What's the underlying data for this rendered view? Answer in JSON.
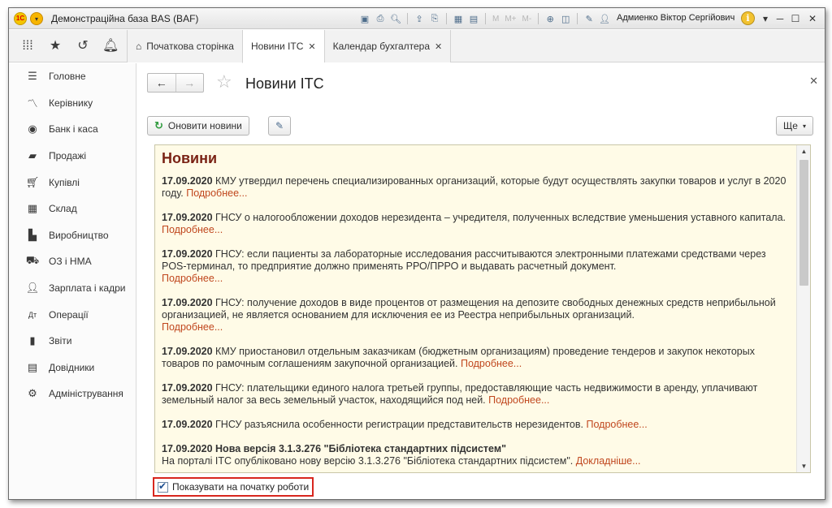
{
  "window": {
    "title": "Демонстраційна база BAS  (BAF)",
    "user": "Адмиенко Віктор Сергійович",
    "toolbar_labels": {
      "m": "M",
      "m_plus": "M+",
      "m_minus": "M-"
    }
  },
  "tabs": [
    {
      "label": "Початкова сторінка",
      "active": false,
      "closable": false
    },
    {
      "label": "Новини ІТС",
      "active": true,
      "closable": true
    },
    {
      "label": "Календар бухгалтера",
      "active": false,
      "closable": true
    }
  ],
  "sidebar": {
    "items": [
      {
        "label": "Головне",
        "icon": "menu-lines-icon"
      },
      {
        "label": "Керівнику",
        "icon": "trend-icon"
      },
      {
        "label": "Банк і каса",
        "icon": "coin-icon"
      },
      {
        "label": "Продажі",
        "icon": "bag-icon"
      },
      {
        "label": "Купівлі",
        "icon": "cart-icon"
      },
      {
        "label": "Склад",
        "icon": "grid-icon"
      },
      {
        "label": "Виробництво",
        "icon": "factory-icon"
      },
      {
        "label": "ОЗ і НМА",
        "icon": "truck-icon"
      },
      {
        "label": "Зарплата і кадри",
        "icon": "person-icon"
      },
      {
        "label": "Операції",
        "icon": "dt-kt-icon"
      },
      {
        "label": "Звіти",
        "icon": "bar-chart-icon"
      },
      {
        "label": "Довідники",
        "icon": "book-icon"
      },
      {
        "label": "Адміністрування",
        "icon": "gear-icon"
      }
    ]
  },
  "form": {
    "title": "Новини ІТС",
    "refresh_label": "Оновити новини",
    "more_label": "Ще"
  },
  "news": {
    "title": "Новини",
    "more_link": "Подробнее...",
    "items": [
      {
        "date": "17.09.2020",
        "text": " КМУ утвердил перечень специализированных организаций, которые будут осуществлять закупки товаров и услуг в 2020 году. "
      },
      {
        "date": "17.09.2020",
        "text": " ГНСУ о налогообложении доходов нерезидента – учредителя, полученных вследствие уменьшения уставного капитала. "
      },
      {
        "date": "17.09.2020",
        "text": " ГНСУ: если пациенты за лабораторные исследования рассчитываются электронными платежами средствами через POS-терминал, то предприятие должно применять РРО/ПРРО и выдавать расчетный документ."
      },
      {
        "date": "17.09.2020",
        "text": " ГНСУ: получение доходов в виде процентов от размещения на депозите свободных денежных средств неприбыльной организацией, не является основанием для исключения ее из Реестра неприбыльных организаций."
      },
      {
        "date": "17.09.2020",
        "text": " КМУ приостановил отдельным заказчикам (бюджетным организациям) проведение тендеров и закупок некоторых товаров по рамочным соглашениям закупочной организацией. "
      },
      {
        "date": "17.09.2020",
        "text": " ГНСУ: плательщики единого налога третьей группы, предоставляющие часть недвижимости в аренду, уплачивают земельный налог за весь земельный участок, находящийся под ней. "
      },
      {
        "date": "17.09.2020",
        "text": " ГНСУ разъяснила особенности регистрации представительств нерезидентов. "
      }
    ],
    "last": {
      "headline": "17.09.2020 Нова версія 3.1.3.276 \"Бібліотека стандартних підсистем\"",
      "text": "На порталі ІТС опубліковано нову версію 3.1.3.276 \"Бібліотека стандартних підсистем\". ",
      "link": "Докладніше..."
    }
  },
  "footer": {
    "show_at_start_label": "Показувати на початку роботи",
    "show_at_start_checked": true
  }
}
